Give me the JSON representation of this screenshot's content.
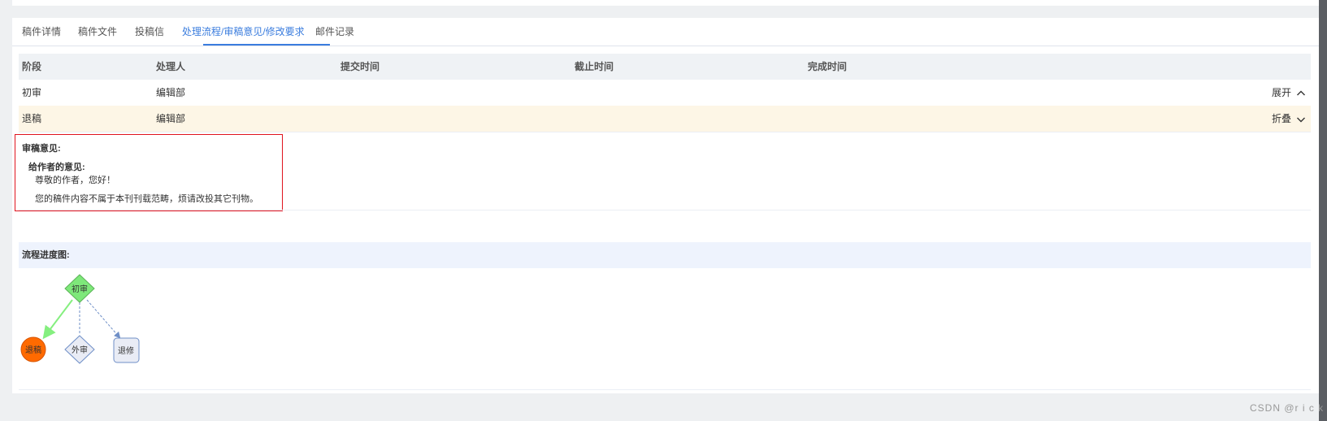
{
  "tabs": [
    {
      "label": "稿件详情"
    },
    {
      "label": "稿件文件"
    },
    {
      "label": "投稿信"
    },
    {
      "label": "处理流程/审稿意见/修改要求"
    },
    {
      "label": "邮件记录"
    }
  ],
  "active_tab_index": 3,
  "table": {
    "headers": [
      "阶段",
      "处理人",
      "提交时间",
      "截止时间",
      "完成时间"
    ],
    "rows": [
      {
        "stage": "初审",
        "handler": "编辑部",
        "submit_time": "",
        "deadline": "",
        "done_time": "",
        "toggle": "展开",
        "expanded": false
      },
      {
        "stage": "退稿",
        "handler": "编辑部",
        "submit_time": "",
        "deadline": "",
        "done_time": "",
        "toggle": "折叠",
        "expanded": true,
        "selected": true
      }
    ]
  },
  "review": {
    "title": "审稿意见:",
    "to_author_label": "给作者的意见:",
    "greeting": "尊敬的作者，您好！",
    "body": "您的稿件内容不属于本刊刊载范畴，烦请改投其它刊物。"
  },
  "flow": {
    "title": "流程进度图:",
    "nodes": {
      "first_review": "初审",
      "reject": "退稿",
      "external_review": "外审",
      "revise": "退修"
    },
    "colors": {
      "first_review": "#7ee87a",
      "reject": "#ff6a00",
      "external_review": "#e9ecf5",
      "revise": "#e9ecf5",
      "active_edge": "#85ef7f",
      "pending_edge": "#6f8fc7"
    }
  },
  "watermark": "CSDN @r i c k"
}
